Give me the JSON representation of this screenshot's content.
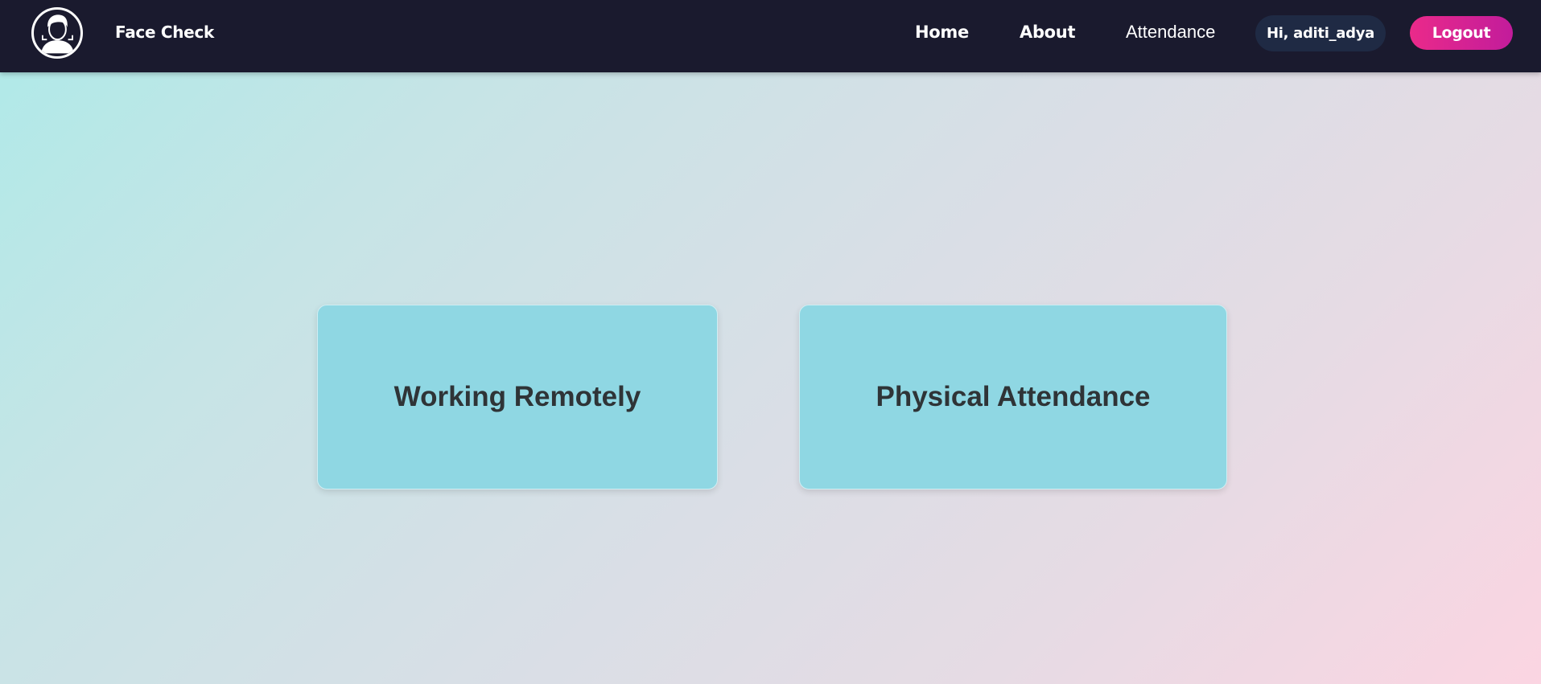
{
  "navbar": {
    "logo_icon": "face-scan-icon",
    "brand": "Face Check",
    "links": [
      {
        "label": "Home"
      },
      {
        "label": "About"
      },
      {
        "label": "Attendance"
      }
    ],
    "greeting": "Hi, aditi_adya",
    "logout_label": "Logout",
    "background_color": "#1a1a2e",
    "logout_color": "#e62a8c"
  },
  "main": {
    "options": [
      {
        "label": "Working Remotely"
      },
      {
        "label": "Physical Attendance"
      }
    ],
    "card_color": "#8fd7e3"
  }
}
